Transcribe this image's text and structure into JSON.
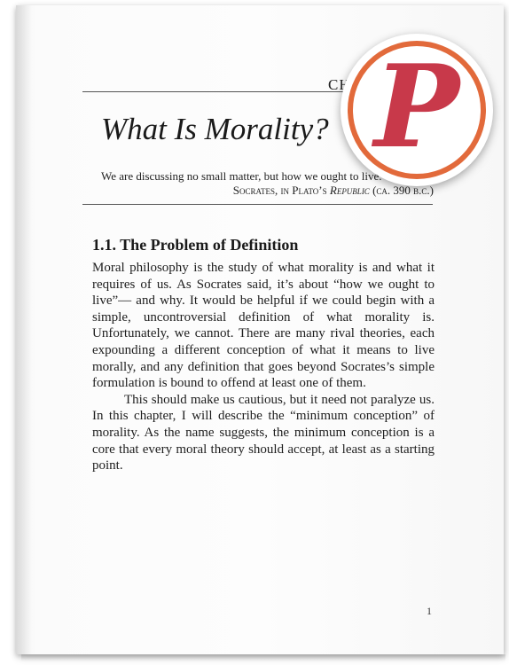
{
  "chapter": {
    "label": "CH",
    "title": "What Is Morality?"
  },
  "epigraph": {
    "quote": "We are discussing no small matter, but how we ought to live.",
    "source_author": "Socrates, in Plato’s ",
    "source_work": "Republic",
    "source_date": " (ca. 390 b.c.)"
  },
  "section": {
    "heading": "1.1.  The Problem of Definition",
    "paragraphs": [
      "Moral philosophy is the study of what morality is and what it requires of us. As Socrates said, it’s about “how we ought to live”— and why. It would be helpful if we could begin with a simple, uncontroversial definition of what morality is. Unfortunately, we cannot. There are many rival theories, each expounding a different conception of what it means to live morally, and any definition that goes beyond Socrates’s simple formulation is bound to offend at least one of them.",
      "This should make us cautious, but it need not paralyze us. In this chapter, I will describe the “minimum conception” of morality. As the name suggests, the minimum conception is a core that every moral theory should accept, at least as a starting point."
    ]
  },
  "page_number": "1",
  "badge": {
    "letter": "P",
    "ring_color": "#e26a3b",
    "letter_color": "#c8394a"
  }
}
